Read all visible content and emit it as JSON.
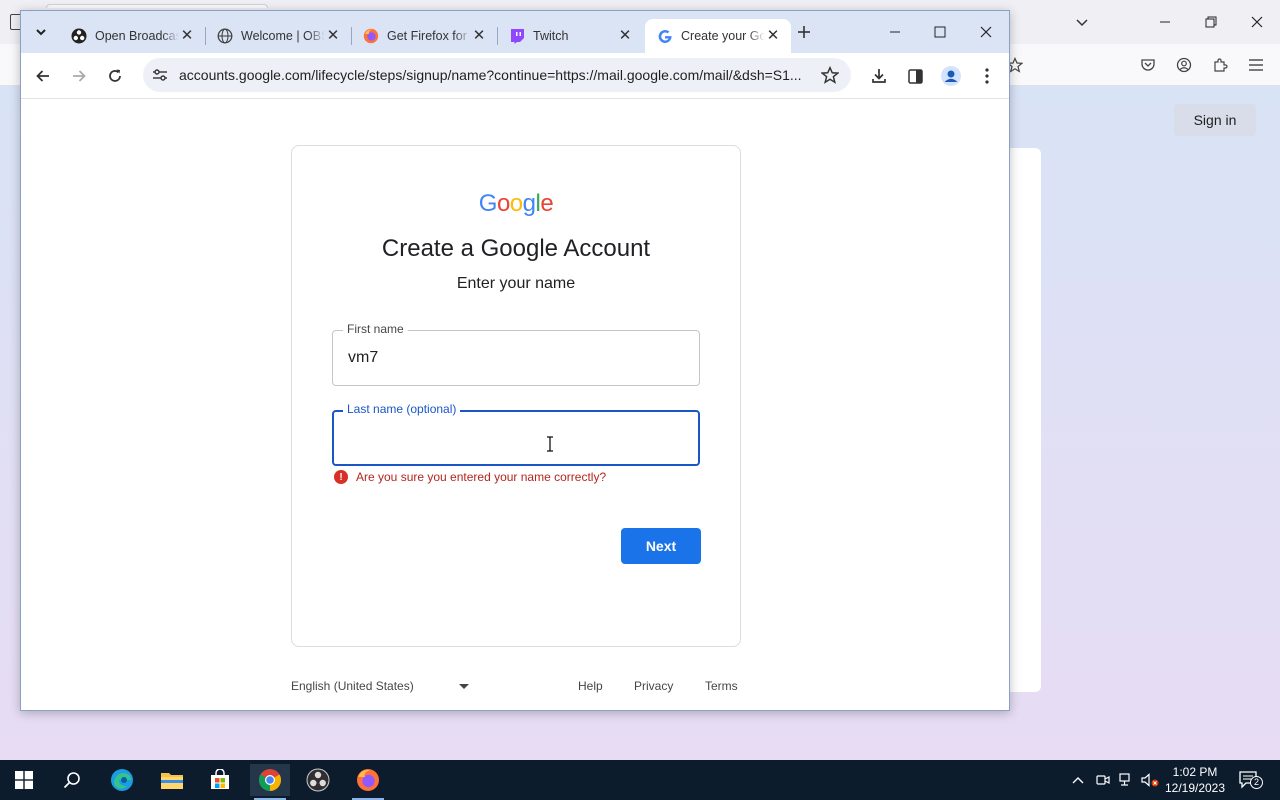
{
  "background_window": {
    "sign_in_label": "Sign in"
  },
  "chrome": {
    "tabs": [
      {
        "title": "Open Broadcaster Software",
        "icon": "obs-icon"
      },
      {
        "title": "Welcome | OBS",
        "icon": "globe-icon"
      },
      {
        "title": "Get Firefox for desktop",
        "icon": "firefox-icon"
      },
      {
        "title": "Twitch",
        "icon": "twitch-icon"
      },
      {
        "title": "Create your Google Account",
        "icon": "google-icon"
      }
    ],
    "url": "accounts.google.com/lifecycle/steps/signup/name?continue=https://mail.google.com/mail/&dsh=S1..."
  },
  "signup": {
    "logo_letters": [
      "G",
      "o",
      "o",
      "g",
      "l",
      "e"
    ],
    "logo_colors": [
      "#4285f4",
      "#ea4335",
      "#fbbc05",
      "#4285f4",
      "#34a853",
      "#ea4335"
    ],
    "heading": "Create a Google Account",
    "subheading": "Enter your name",
    "first_name_label": "First name",
    "first_name_value": "vm7",
    "last_name_label": "Last name (optional)",
    "last_name_value": "",
    "error_text": "Are you sure you entered your name correctly?",
    "next_label": "Next"
  },
  "footer": {
    "language": "English (United States)",
    "help": "Help",
    "privacy": "Privacy",
    "terms": "Terms"
  },
  "taskbar": {
    "time": "1:02 PM",
    "date": "12/19/2023",
    "notification_count": "2"
  },
  "colors": {
    "accent_blue": "#1a73e8",
    "error_red": "#b3261e",
    "tabbar": "#dbe4f5"
  }
}
